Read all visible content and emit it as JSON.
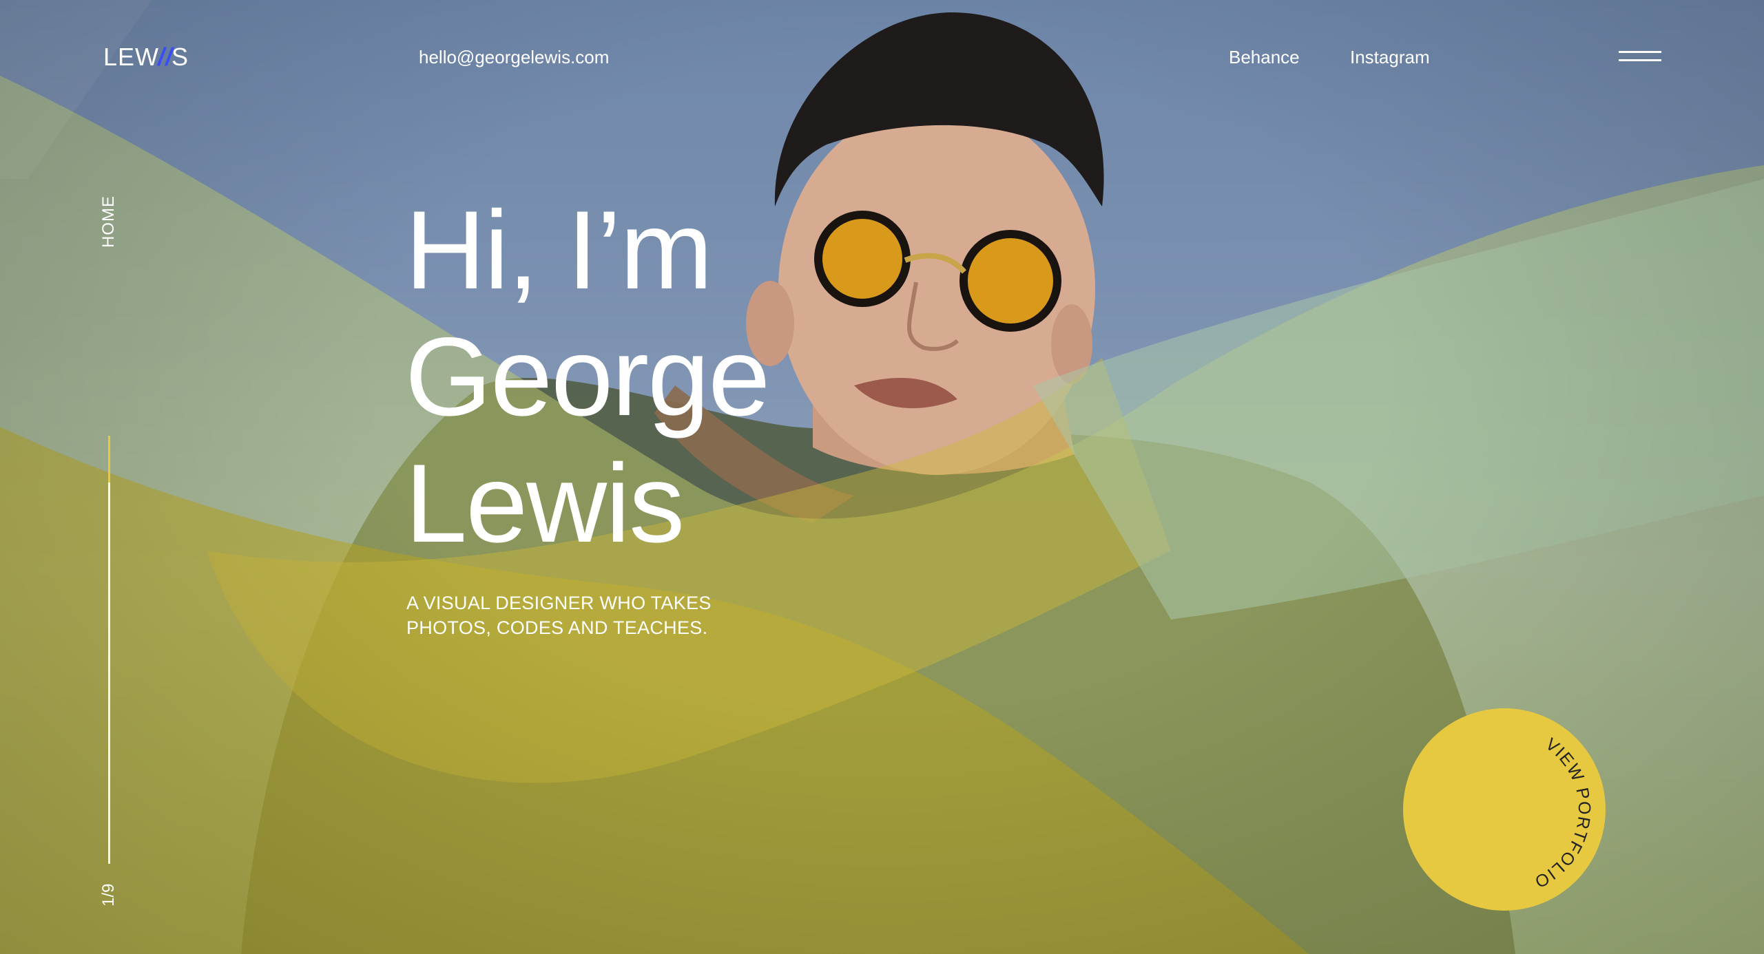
{
  "header": {
    "logo_text": "LEWIS",
    "logo_prefix": "LEW",
    "logo_slash": "//",
    "logo_suffix": "S",
    "email": "hello@georgelewis.com",
    "nav": [
      {
        "label": "Behance"
      },
      {
        "label": "Instagram"
      }
    ],
    "menu_icon": "hamburger-icon"
  },
  "sidebar": {
    "section_label": "HOME",
    "slide_counter": "1/9",
    "progress_fraction": 0.11
  },
  "hero": {
    "title_lines": [
      "Hi, I’m",
      "George",
      "Lewis"
    ],
    "subtitle_lines": [
      "A VISUAL DESIGNER WHO TAKES",
      "PHOTOS, CODES AND TEACHES."
    ]
  },
  "cta": {
    "label": "VIEW PORTFOLIO"
  },
  "colors": {
    "accent_yellow": "#e6c940",
    "logo_slash_blue": "#3b4ef5",
    "text": "#ffffff"
  }
}
